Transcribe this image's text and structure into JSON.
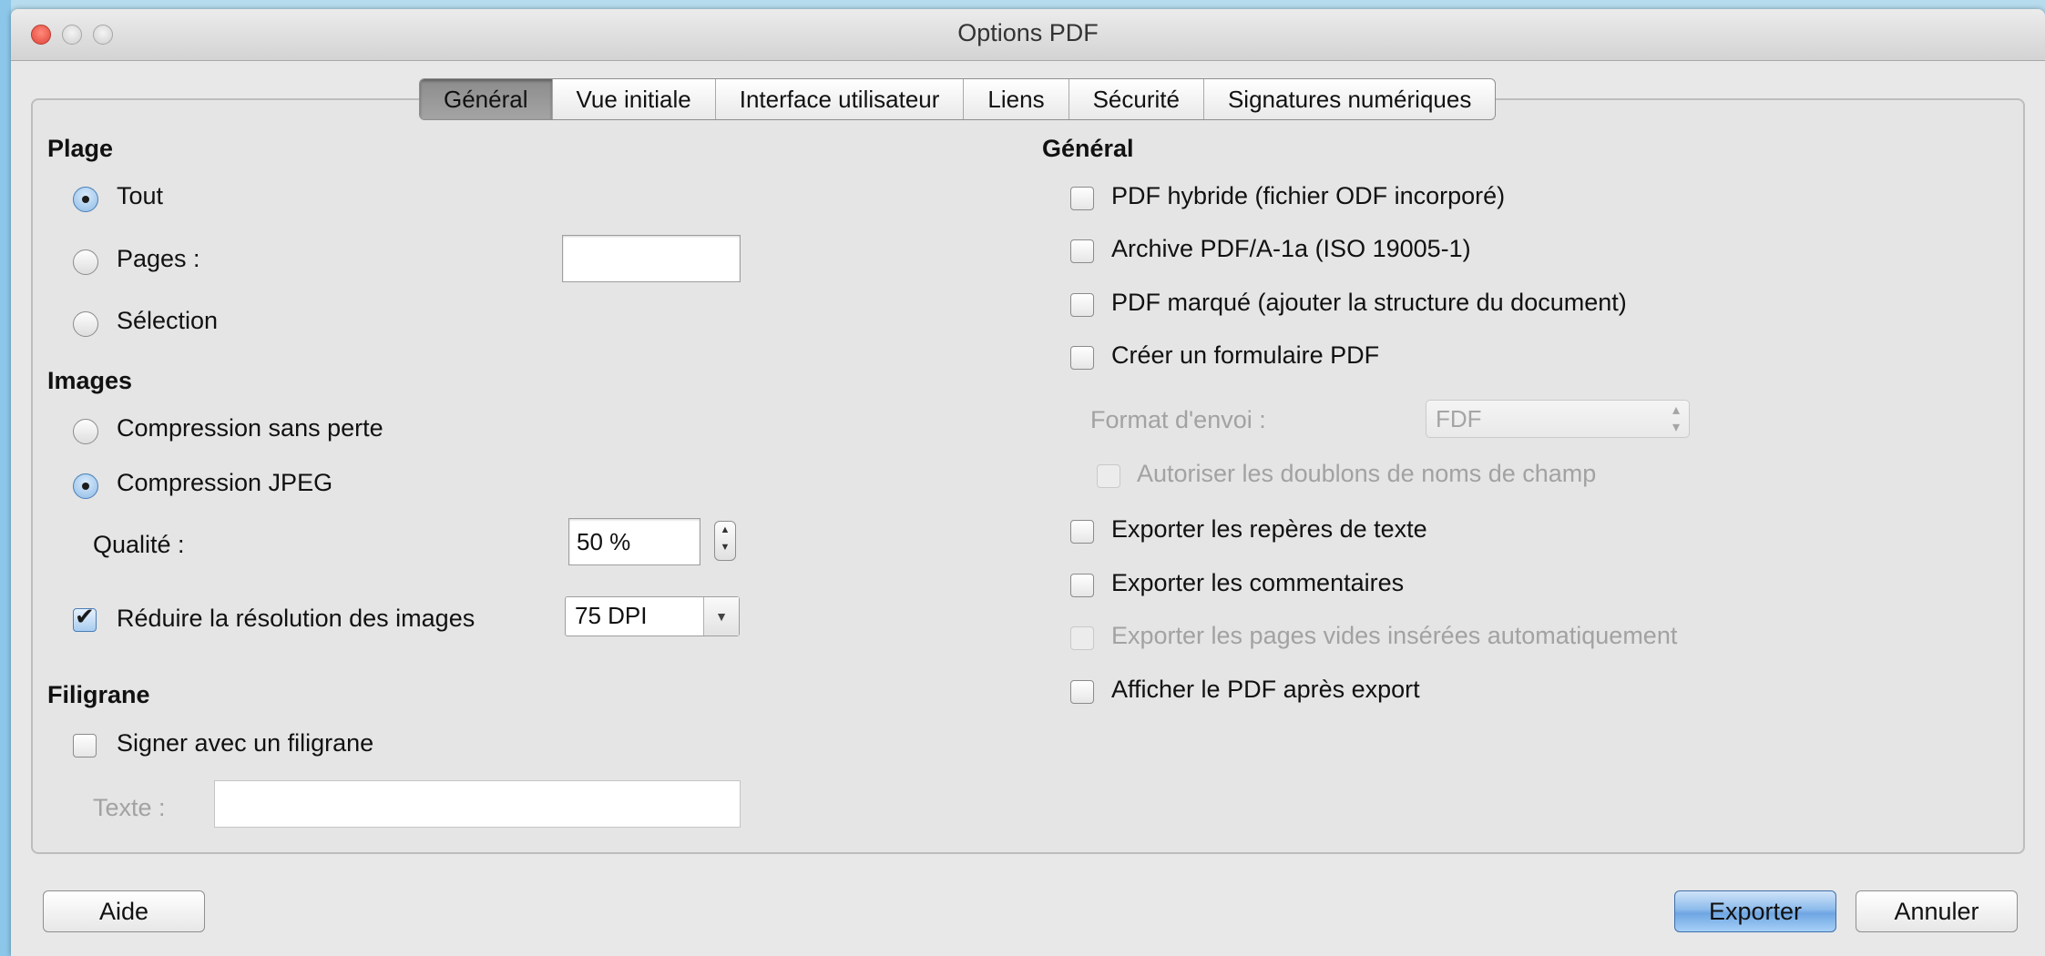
{
  "window": {
    "title": "Options PDF"
  },
  "tabs": [
    "Général",
    "Vue initiale",
    "Interface utilisateur",
    "Liens",
    "Sécurité",
    "Signatures numériques"
  ],
  "range": {
    "title": "Plage",
    "all": "Tout",
    "pages": "Pages :",
    "pages_value": "",
    "selection": "Sélection",
    "selected": "Tout"
  },
  "images": {
    "title": "Images",
    "lossless": "Compression sans perte",
    "jpeg": "Compression JPEG",
    "selected": "Compression JPEG",
    "quality_label": "Qualité :",
    "quality_value": "50 %",
    "reduce_label": "Réduire la résolution des images",
    "reduce_checked": true,
    "dpi_value": "75 DPI"
  },
  "watermark": {
    "title": "Filigrane",
    "sign_label": "Signer avec un filigrane",
    "sign_checked": false,
    "text_label": "Texte :",
    "text_value": ""
  },
  "general": {
    "title": "Général",
    "hybrid": "PDF hybride (fichier ODF incorporé)",
    "archive": "Archive PDF/A-1a (ISO 19005-1)",
    "tagged": "PDF marqué (ajouter la structure du document)",
    "form": "Créer un formulaire PDF",
    "submit_format_label": "Format d'envoi :",
    "submit_format_value": "FDF",
    "allow_duplicates": "Autoriser les doublons de noms de champ",
    "export_bookmarks": "Exporter les repères de texte",
    "export_comments": "Exporter les commentaires",
    "export_blank_pages": "Exporter les pages vides insérées automatiquement",
    "view_after_export": "Afficher le PDF après export"
  },
  "buttons": {
    "help": "Aide",
    "export": "Exporter",
    "cancel": "Annuler"
  },
  "colors": {
    "desktop": "#b8dcef",
    "window": "#e8e8e8",
    "accent": "#6fa6e3",
    "close": "#e0443a"
  }
}
